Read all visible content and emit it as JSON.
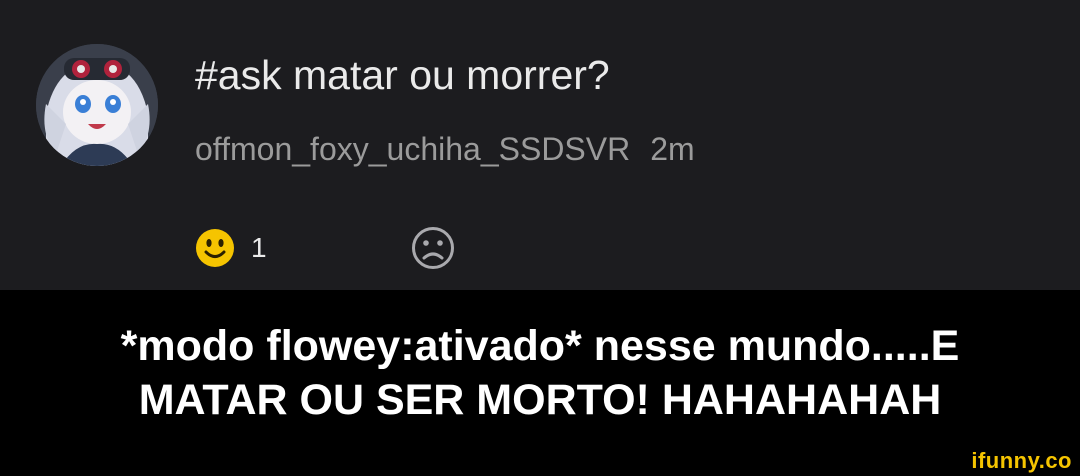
{
  "post": {
    "title": "#ask matar ou morrer?",
    "username": "offmon_foxy_uchiha_SSDSVR",
    "time": "2m",
    "reactions": {
      "happy": {
        "icon": "smile-emoji-icon",
        "count": "1"
      },
      "sad": {
        "icon": "frown-icon"
      }
    }
  },
  "caption": {
    "line1": "*modo flowey:ativado* nesse mundo.....E",
    "line2": "MATAR OU SER MORTO! HAHAHAHAH"
  },
  "watermark": "ifunny.co",
  "colors": {
    "post_background": "#1c1c1f",
    "caption_background": "#000000",
    "title_text": "#eaeaea",
    "meta_text": "#9b9b9b",
    "happy_emoji": "#f5c400",
    "watermark": "#f5c400"
  }
}
